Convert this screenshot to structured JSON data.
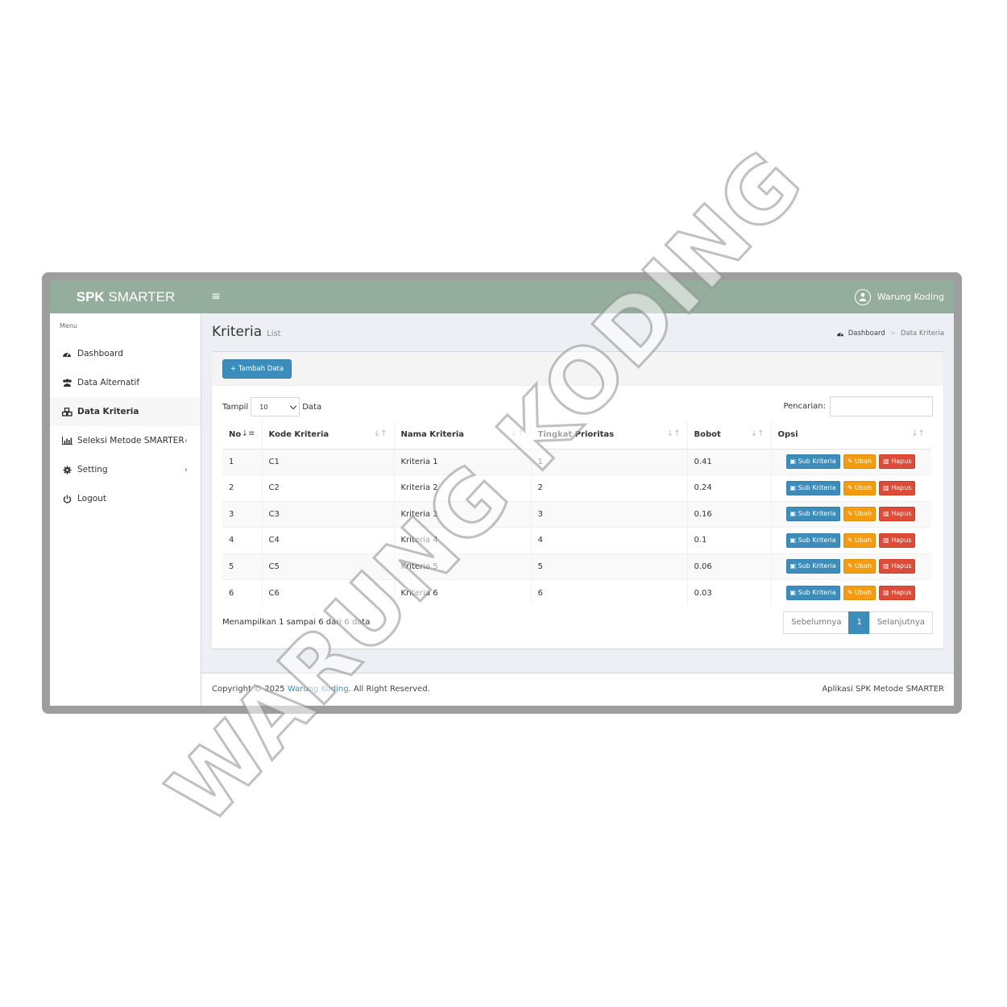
{
  "app": {
    "logo_bold": "SPK",
    "logo_rest": "SMARTER",
    "menu_toggle": "≡",
    "user_name": "Warung Koding"
  },
  "colors": {
    "topbar": "#94ad9c",
    "primary": "#3c8dbc",
    "warning": "#f39c12",
    "danger": "#dd4b39"
  },
  "sidebar": {
    "header": "Menu",
    "items": [
      {
        "label": "Dashboard",
        "icon": "dashboard-icon",
        "active": false
      },
      {
        "label": "Data Alternatif",
        "icon": "users-icon",
        "active": false
      },
      {
        "label": "Data Kriteria",
        "icon": "cubes-icon",
        "active": true
      },
      {
        "label": "Seleksi Metode SMARTER",
        "icon": "bar-chart-icon",
        "active": false,
        "chevron": "‹"
      },
      {
        "label": "Setting",
        "icon": "gear-icon",
        "active": false,
        "chevron": "‹"
      },
      {
        "label": "Logout",
        "icon": "power-icon",
        "active": false
      }
    ]
  },
  "page": {
    "title": "Kriteria",
    "subtitle": "List",
    "breadcrumb": {
      "home": "Dashboard",
      "sep": ">",
      "current": "Data Kriteria"
    }
  },
  "toolbar": {
    "add_button": "+ Tambah Data"
  },
  "table_controls": {
    "show_label": "Tampil",
    "show_value": "10",
    "show_suffix": "Data",
    "search_label": "Pencarian:"
  },
  "table": {
    "headers": [
      "No",
      "Kode Kriteria",
      "Nama Kriteria",
      "Tingkat Prioritas",
      "Bobot",
      "Opsi"
    ],
    "rows": [
      {
        "no": "1",
        "kode": "C1",
        "nama": "Kriteria 1",
        "prioritas": "1",
        "bobot": "0.41"
      },
      {
        "no": "2",
        "kode": "C2",
        "nama": "Kriteria 2",
        "prioritas": "2",
        "bobot": "0.24"
      },
      {
        "no": "3",
        "kode": "C3",
        "nama": "Kriteria 3",
        "prioritas": "3",
        "bobot": "0.16"
      },
      {
        "no": "4",
        "kode": "C4",
        "nama": "Kriteria 4",
        "prioritas": "4",
        "bobot": "0.1"
      },
      {
        "no": "5",
        "kode": "C5",
        "nama": "Kriteria 5",
        "prioritas": "5",
        "bobot": "0.06"
      },
      {
        "no": "6",
        "kode": "C6",
        "nama": "Kriteria 6",
        "prioritas": "6",
        "bobot": "0.03"
      }
    ],
    "actions": {
      "sub": "Sub Kriteria",
      "edit": "Ubah",
      "delete": "Hapus"
    }
  },
  "pagination": {
    "info": "Menampilkan 1 sampai 6 dari 6 data",
    "prev": "Sebelumnya",
    "current": "1",
    "next": "Selanjutnya"
  },
  "footer": {
    "left_prefix": "Copyright © 2025 ",
    "left_link": "Warung Koding",
    "left_suffix": ". All Right Reserved.",
    "right": "Aplikasi SPK Metode SMARTER"
  },
  "watermark": {
    "text": "WARUNG KODING"
  }
}
